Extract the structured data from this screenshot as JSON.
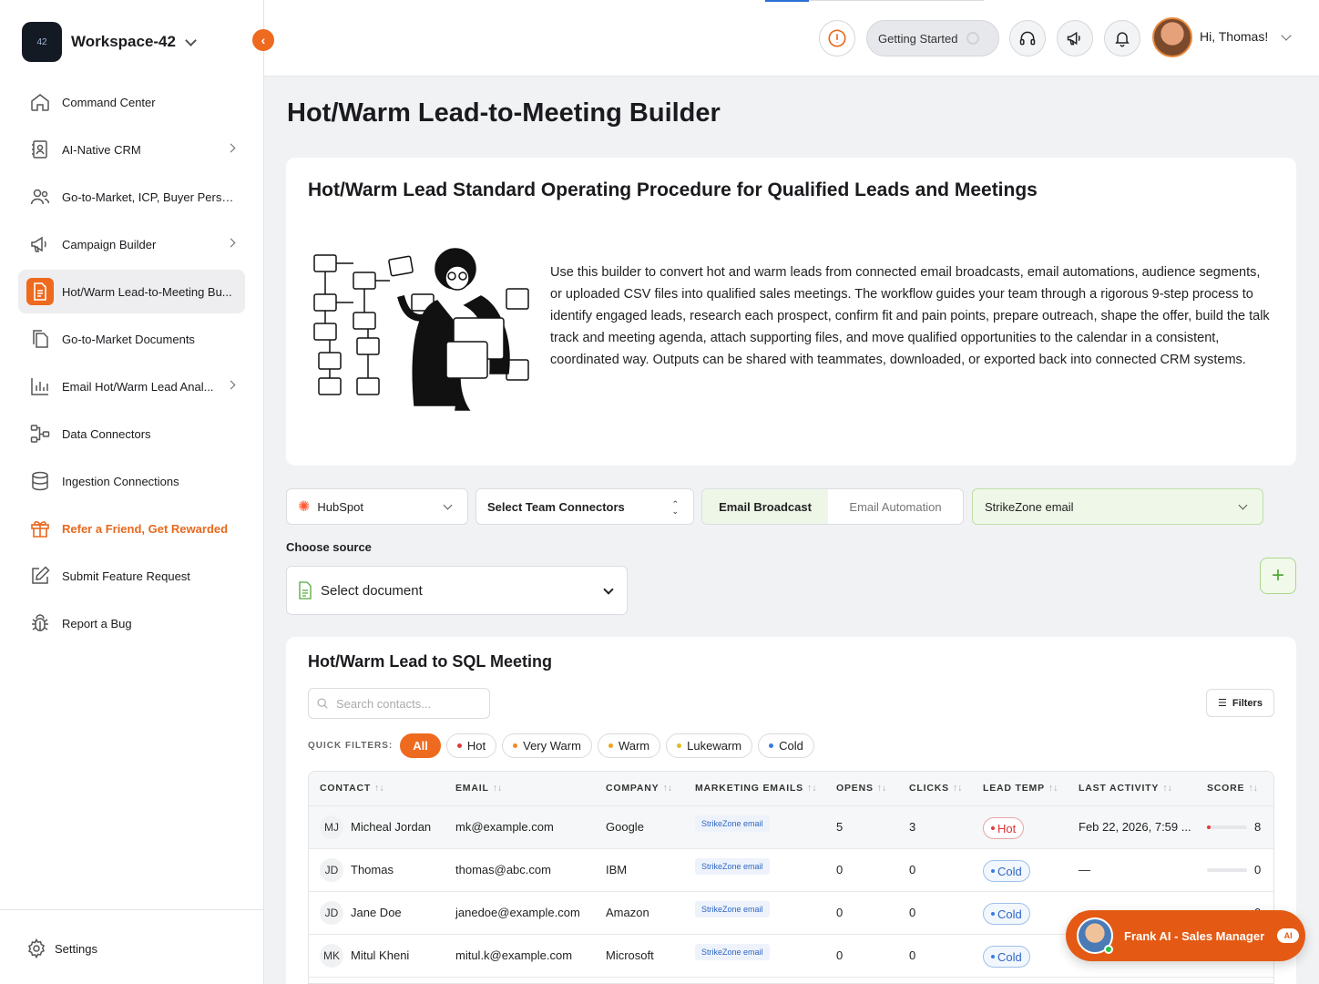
{
  "workspace": {
    "name": "Workspace-42",
    "logo_text": "42"
  },
  "sidebar": {
    "items": [
      {
        "label": "Command Center",
        "icon": "home-icon"
      },
      {
        "label": "AI-Native CRM",
        "icon": "crm-icon",
        "has_submenu": true
      },
      {
        "label": "Go-to-Market, ICP, Buyer Perso...",
        "icon": "users-icon"
      },
      {
        "label": "Campaign Builder",
        "icon": "megaphone-icon",
        "has_submenu": true
      },
      {
        "label": "Hot/Warm Lead-to-Meeting Bu...",
        "icon": "document-icon",
        "active": true
      },
      {
        "label": "Go-to-Market Documents",
        "icon": "documents-icon"
      },
      {
        "label": "Email Hot/Warm Lead Anal...",
        "icon": "bar-chart-icon",
        "has_submenu": true
      },
      {
        "label": "Data Connectors",
        "icon": "connectors-icon"
      },
      {
        "label": "Ingestion Connections",
        "icon": "database-icon"
      },
      {
        "label": "Refer a Friend, Get Rewarded",
        "icon": "gift-icon"
      },
      {
        "label": "Submit Feature Request",
        "icon": "edit-icon"
      },
      {
        "label": "Report a Bug",
        "icon": "bug-icon"
      }
    ],
    "settings_label": "Settings"
  },
  "topbar": {
    "getting_started": "Getting Started",
    "greeting": "Hi, Thomas!"
  },
  "page": {
    "title": "Hot/Warm Lead-to-Meeting Builder",
    "intro_title": "Hot/Warm Lead Standard Operating Procedure for Qualified Leads and Meetings",
    "intro_text": "Use this builder to convert hot and warm leads from connected email broadcasts, email automations, audience segments, or uploaded CSV files into qualified sales meetings. The workflow guides your team through a rigorous 9-step process to identify engaged leads, research each prospect, confirm fit and pain points, prepare outreach, shape the offer, build the talk track and meeting agenda, attach supporting files, and move qualified opportunities to the calendar in a consistent, coordinated way. Outputs can be shared with teammates, downloaded, or exported back into connected CRM systems."
  },
  "controls": {
    "crm": "HubSpot",
    "team_connectors": "Select Team Connectors",
    "segment_active": "Email Broadcast",
    "segment_inactive": "Email Automation",
    "email_source": "StrikeZone email",
    "choose_source_label": "Choose source",
    "select_document": "Select document",
    "add_label": "+"
  },
  "table_section": {
    "title": "Hot/Warm Lead to SQL Meeting",
    "search_placeholder": "Search contacts...",
    "filters_label": "Filters",
    "quick_filters_label": "QUICK FILTERS:",
    "quick_filters": [
      {
        "label": "All",
        "color": ""
      },
      {
        "label": "Hot",
        "color": "#e03a3a"
      },
      {
        "label": "Very Warm",
        "color": "#f08c1c"
      },
      {
        "label": "Warm",
        "color": "#f2a21b"
      },
      {
        "label": "Lukewarm",
        "color": "#e6b91a"
      },
      {
        "label": "Cold",
        "color": "#3a7be0"
      }
    ],
    "columns": [
      "CONTACT",
      "EMAIL",
      "COMPANY",
      "MARKETING EMAILS",
      "OPENS",
      "CLICKS",
      "LEAD TEMP",
      "LAST ACTIVITY",
      "SCORE"
    ],
    "sort_glyph": "↑↓",
    "rows": [
      {
        "initials": "MJ",
        "name": "Micheal Jordan",
        "email": "mk@example.com",
        "company": "Google",
        "marketing": "StrikeZone email",
        "opens": "5",
        "clicks": "3",
        "temp": "Hot",
        "temp_kind": "hot",
        "last_activity": "Feb 22, 2026, 7:59 ...",
        "score": "8",
        "score_fraction": 0.08
      },
      {
        "initials": "JD",
        "name": "Thomas",
        "email": "thomas@abc.com",
        "company": "IBM",
        "marketing": "StrikeZone email",
        "opens": "0",
        "clicks": "0",
        "temp": "Cold",
        "temp_kind": "cold",
        "last_activity": "—",
        "score": "0",
        "score_fraction": 0
      },
      {
        "initials": "JD",
        "name": "Jane Doe",
        "email": "janedoe@example.com",
        "company": "Amazon",
        "marketing": "StrikeZone email",
        "opens": "0",
        "clicks": "0",
        "temp": "Cold",
        "temp_kind": "cold",
        "last_activity": "—",
        "score": "0",
        "score_fraction": 0
      },
      {
        "initials": "MK",
        "name": "Mitul Kheni",
        "email": "mitul.k@example.com",
        "company": "Microsoft",
        "marketing": "StrikeZone email",
        "opens": "0",
        "clicks": "0",
        "temp": "Cold",
        "temp_kind": "cold",
        "last_activity": "—",
        "score": "0",
        "score_fraction": 0
      }
    ]
  },
  "assistant": {
    "name": "Frank AI - Sales Manager",
    "badge": "AI"
  },
  "colors": {
    "accent": "#ee6a1e",
    "green_accent": "#55a83a",
    "hot": "#e03a3a",
    "cold": "#2f66c3"
  }
}
